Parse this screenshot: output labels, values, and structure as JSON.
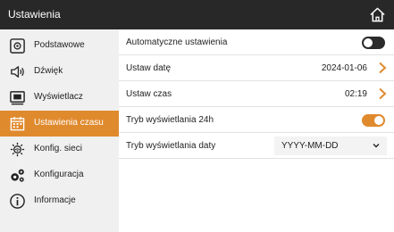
{
  "header": {
    "title": "Ustawienia",
    "home_icon": "home-icon"
  },
  "sidebar": {
    "active_color": "#e08a2e",
    "items": [
      {
        "label": "Podstawowe",
        "icon": "basic-settings-icon"
      },
      {
        "label": "Dźwięk",
        "icon": "speaker-icon"
      },
      {
        "label": "Wyświetlacz",
        "icon": "display-icon"
      },
      {
        "label": "Ustawienia czasu",
        "icon": "calendar-icon",
        "active": true
      },
      {
        "label": "Konfig. sieci",
        "icon": "network-icon"
      },
      {
        "label": "Konfiguracja",
        "icon": "gears-icon"
      },
      {
        "label": "Informacje",
        "icon": "info-icon"
      }
    ]
  },
  "main": {
    "rows": [
      {
        "label": "Automatyczne ustawienia",
        "control": "toggle",
        "state": "off"
      },
      {
        "label": "Ustaw datę",
        "value": "2024-01-06",
        "control": "chevron"
      },
      {
        "label": "Ustaw czas",
        "value": "02:19",
        "control": "chevron"
      },
      {
        "label": "Tryb wyświetlania 24h",
        "control": "toggle",
        "state": "on"
      },
      {
        "label": "Tryb wyświetlania daty",
        "control": "select",
        "selected": "YYYY-MM-DD"
      }
    ]
  },
  "colors": {
    "header_bg": "#282828",
    "sidebar_bg": "#f0f0f0",
    "accent": "#e08a2e",
    "toggle_off": "#2b2b2b"
  }
}
